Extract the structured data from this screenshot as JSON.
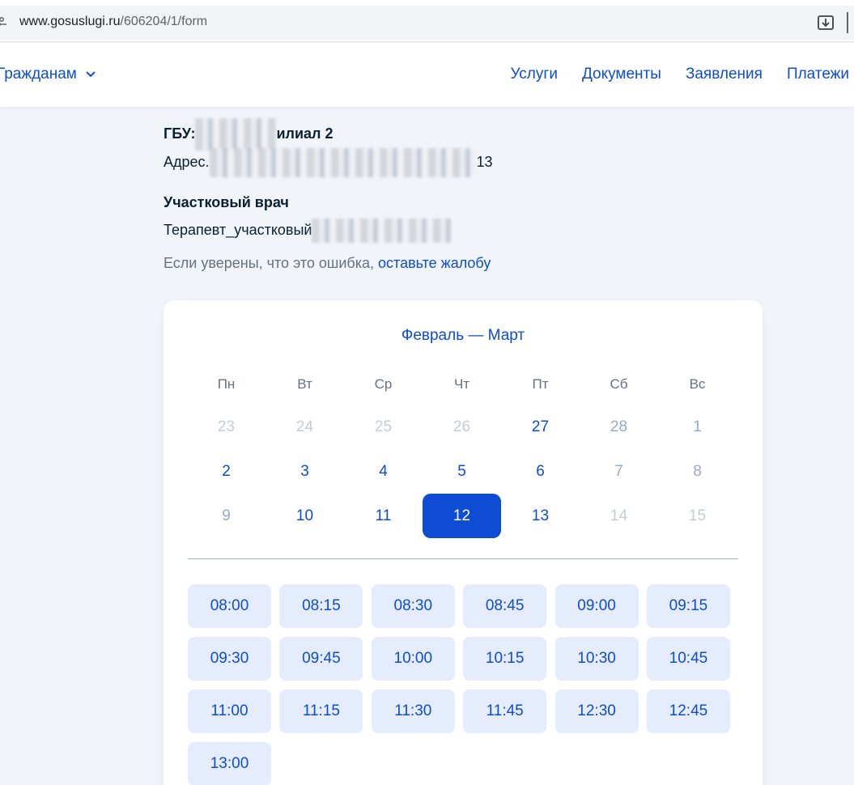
{
  "browser": {
    "url_host": "www.gosuslugi.ru",
    "url_path": "/606204/1/form"
  },
  "header": {
    "citizens_label": "Гражданам",
    "nav": [
      "Услуги",
      "Документы",
      "Заявления",
      "Платежи"
    ]
  },
  "info": {
    "org_prefix": "ГБУ:",
    "org_suffix": "илиал 2",
    "address_prefix": "Адрес.",
    "address_suffix": "13",
    "doctor_heading": "Участковый врач",
    "doctor_name": "Терапевт_участковый",
    "error_text": "Если уверены, что это ошибка, ",
    "error_link": "оставьте жалобу"
  },
  "calendar": {
    "title": "Февраль — Март",
    "weekdays": [
      "Пн",
      "Вт",
      "Ср",
      "Чт",
      "Пт",
      "Сб",
      "Вс"
    ],
    "days": [
      {
        "label": "23",
        "state": "muted"
      },
      {
        "label": "24",
        "state": "muted"
      },
      {
        "label": "25",
        "state": "muted"
      },
      {
        "label": "26",
        "state": "muted"
      },
      {
        "label": "27",
        "state": "active"
      },
      {
        "label": "28",
        "state": "weekend"
      },
      {
        "label": "1",
        "state": "weekend"
      },
      {
        "label": "2",
        "state": "active"
      },
      {
        "label": "3",
        "state": "active"
      },
      {
        "label": "4",
        "state": "active"
      },
      {
        "label": "5",
        "state": "active"
      },
      {
        "label": "6",
        "state": "active"
      },
      {
        "label": "7",
        "state": "weekend"
      },
      {
        "label": "8",
        "state": "weekend"
      },
      {
        "label": "9",
        "state": "weekend"
      },
      {
        "label": "10",
        "state": "active"
      },
      {
        "label": "11",
        "state": "active"
      },
      {
        "label": "12",
        "state": "selected"
      },
      {
        "label": "13",
        "state": "active"
      },
      {
        "label": "14",
        "state": "muted"
      },
      {
        "label": "15",
        "state": "muted"
      }
    ]
  },
  "time_slots": [
    "08:00",
    "08:15",
    "08:30",
    "08:45",
    "09:00",
    "09:15",
    "09:30",
    "09:45",
    "10:00",
    "10:15",
    "10:30",
    "10:45",
    "11:00",
    "11:15",
    "11:30",
    "11:45",
    "12:30",
    "12:45",
    "13:00"
  ],
  "colors": {
    "accent": "#0d4cd3",
    "slot_bg": "#e4ecfd",
    "page_bg": "#f1f4f9"
  }
}
